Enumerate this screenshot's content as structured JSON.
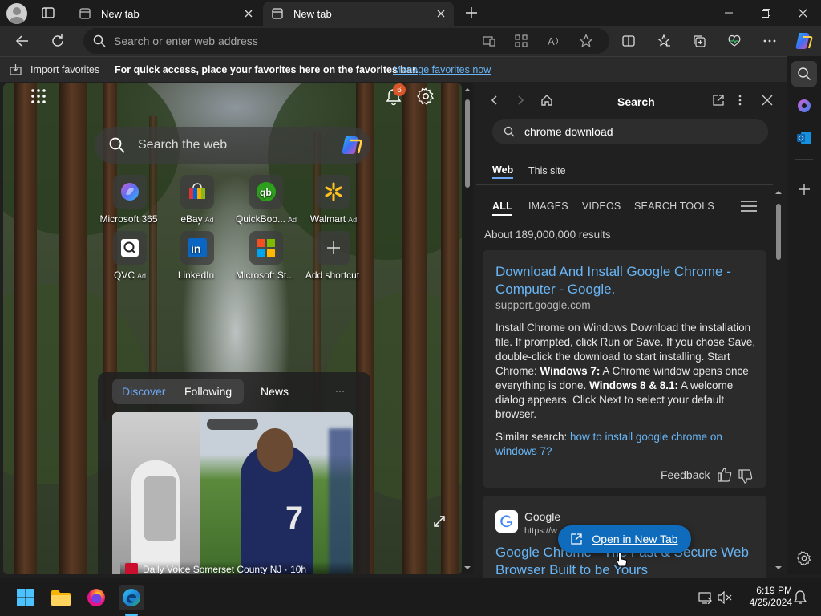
{
  "tabs": [
    {
      "title": "New tab",
      "active": false
    },
    {
      "title": "New tab",
      "active": true
    }
  ],
  "address": {
    "placeholder": "Search or enter web address"
  },
  "favorites_bar": {
    "import_label": "Import favorites",
    "message": "For quick access, place your favorites here on the favorites bar.",
    "manage_link": "Manage favorites now"
  },
  "newtab": {
    "notification_count": "6",
    "search_placeholder": "Search the web",
    "shortcuts": [
      {
        "label": "Microsoft 365",
        "ad": ""
      },
      {
        "label": "eBay",
        "ad": "Ad"
      },
      {
        "label": "QuickBoo...",
        "ad": "Ad"
      },
      {
        "label": "Walmart",
        "ad": "Ad"
      },
      {
        "label": "QVC",
        "ad": "Ad"
      },
      {
        "label": "LinkedIn",
        "ad": ""
      },
      {
        "label": "Microsoft St...",
        "ad": ""
      },
      {
        "label": "Add shortcut",
        "ad": ""
      }
    ],
    "feed": {
      "tabs": [
        "Discover",
        "Following",
        "News"
      ],
      "more": "···",
      "card_source": "Daily Voice Somerset County NJ · 10h"
    }
  },
  "sidepanel": {
    "title": "Search",
    "query": "chrome download",
    "scope_tabs": [
      "Web",
      "This site"
    ],
    "result_tabs": [
      "ALL",
      "IMAGES",
      "VIDEOS",
      "SEARCH TOOLS"
    ],
    "result_count": "About 189,000,000 results",
    "result1": {
      "title": "Download And Install Google Chrome - Computer - Google.",
      "url": "support.google.com",
      "snippet_parts": [
        {
          "t": "Install Chrome on Windows Download the installation file. If prompted, click Run or Save. If you chose Save, double-click the download to start installing. Start Chrome: ",
          "b": false
        },
        {
          "t": "Windows 7:",
          "b": true
        },
        {
          "t": " A Chrome window opens once everything is done. ",
          "b": false
        },
        {
          "t": "Windows 8 & 8.1:",
          "b": true
        },
        {
          "t": " A welcome dialog appears. Click Next to select your default browser.",
          "b": false
        }
      ],
      "similar_prefix": "Similar search: ",
      "similar_link": "how to install google chrome on windows 7?",
      "feedback": "Feedback"
    },
    "result2": {
      "site": "Google",
      "url": "https://w",
      "title": "Google Chrome - The Fast & Secure Web Browser Built to be Yours"
    },
    "open_new_tab": "Open in New Tab"
  },
  "taskbar": {
    "time": "6:19 PM",
    "date": "4/25/2024"
  },
  "colors": {
    "accent": "#0f6cbd",
    "link": "#68b5f5",
    "badge": "#d8572a"
  }
}
